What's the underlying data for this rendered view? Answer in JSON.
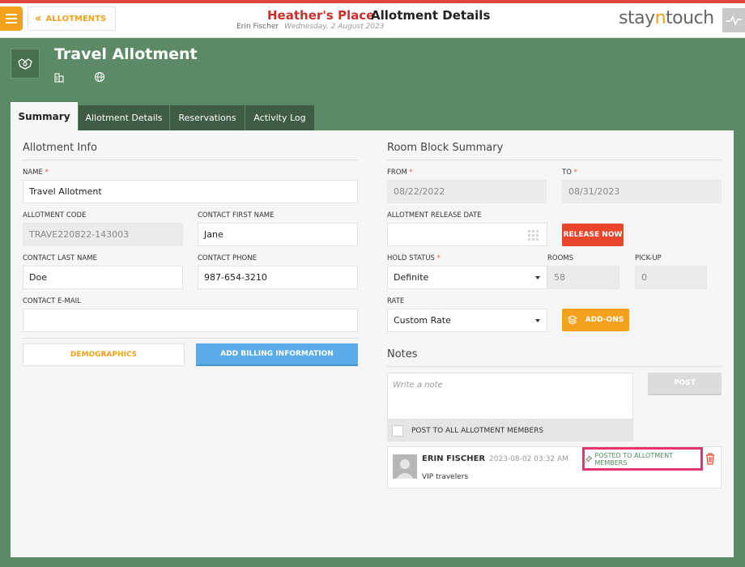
{
  "header": {
    "back_label": "ALLOTMENTS",
    "hotel_name": "Heather's Place",
    "page_title": "Allotment Details",
    "user_name": "Erin Fischer",
    "date": "Wednesday, 2 August 2023",
    "logo_parts": [
      "stay",
      "n",
      "touch"
    ]
  },
  "allotment": {
    "title": "Travel Allotment"
  },
  "tabs": [
    {
      "label": "Summary",
      "active": true
    },
    {
      "label": "Allotment Details"
    },
    {
      "label": "Reservations"
    },
    {
      "label": "Activity Log"
    }
  ],
  "info": {
    "section_title": "Allotment Info",
    "name_label": "NAME",
    "name_value": "Travel Allotment",
    "code_label": "ALLOTMENT CODE",
    "code_value": "TRAVE220822-143003",
    "first_name_label": "CONTACT FIRST NAME",
    "first_name_value": "Jane",
    "last_name_label": "CONTACT LAST NAME",
    "last_name_value": "Doe",
    "phone_label": "CONTACT PHONE",
    "phone_value": "987-654-3210",
    "email_label": "CONTACT E-MAIL",
    "email_value": "",
    "demographics_btn": "DEMOGRAPHICS",
    "billing_btn": "ADD BILLING INFORMATION"
  },
  "room_block": {
    "section_title": "Room Block Summary",
    "from_label": "FROM",
    "from_value": "08/22/2022",
    "to_label": "TO",
    "to_value": "08/31/2023",
    "release_label": "ALLOTMENT RELEASE DATE",
    "release_value": "",
    "release_btn": "RELEASE NOW",
    "hold_label": "HOLD STATUS",
    "hold_value": "Definite",
    "rooms_label": "ROOMS",
    "rooms_value": "58",
    "pickup_label": "PICK-UP",
    "pickup_value": "0",
    "rate_label": "RATE",
    "rate_value": "Custom Rate",
    "addons_btn": "ADD-ONS"
  },
  "notes": {
    "section_title": "Notes",
    "placeholder": "Write a note",
    "post_btn": "POST",
    "post_all_label": "POST TO ALL ALLOTMENT MEMBERS",
    "items": [
      {
        "author": "ERIN FISCHER",
        "timestamp": "2023-08-02 03:32 AM",
        "badge": "POSTED TO ALLOTMENT MEMBERS",
        "text": "VIP travelers"
      }
    ]
  },
  "colors": {
    "accent_orange": "#f0a21e",
    "hotel_red": "#c9302c",
    "background_green": "#5d8a66",
    "highlight_pink": "#e8336d"
  }
}
